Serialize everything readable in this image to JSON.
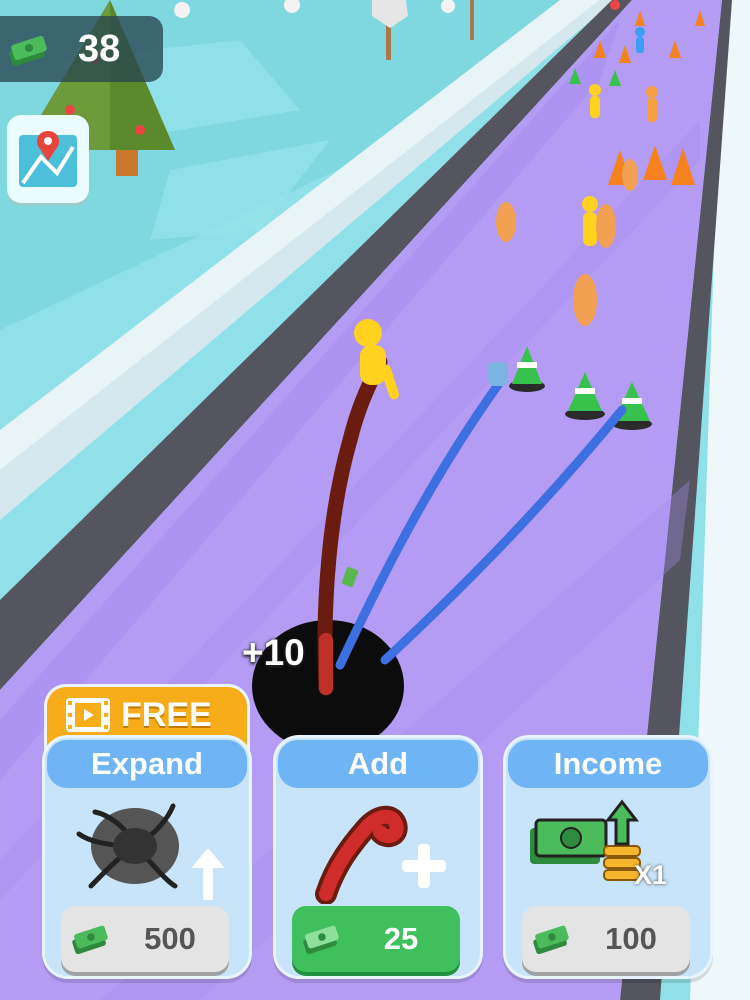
{
  "hud": {
    "money": "38",
    "cash_icon": "cash-stack-icon",
    "map_icon": "map-pin-icon"
  },
  "float_text": "+10",
  "colors": {
    "track": "#b49cf4",
    "track_edge": "#5a5a66",
    "snow": "#e6f3f7",
    "water": "#7fdbe3",
    "card_header": "#6fb4f4",
    "free_tab": "#f7ac1a",
    "green_button": "#40c05c",
    "gray_button": "#e4e4e4"
  },
  "upgrades": [
    {
      "title": "Expand",
      "badge_text": "FREE",
      "badge_icon": "film-strip-icon",
      "art_icon": "black-hole-expand-icon",
      "price": "500",
      "price_icon": "cash-stack-icon",
      "affordable": false
    },
    {
      "title": "Add",
      "art_icon": "tentacle-plus-icon",
      "price": "25",
      "price_icon": "cash-stack-icon",
      "affordable": true
    },
    {
      "title": "Income",
      "art_icon": "money-stack-up-arrow-icon",
      "multiplier": "X1",
      "price": "100",
      "price_icon": "cash-stack-icon",
      "affordable": false
    }
  ]
}
